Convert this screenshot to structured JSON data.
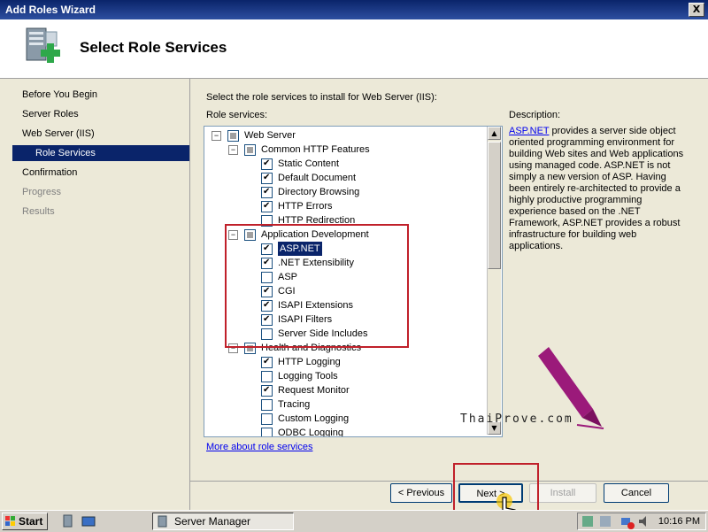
{
  "window": {
    "title": "Add Roles Wizard",
    "close_label": "X"
  },
  "header": {
    "title": "Select Role Services"
  },
  "nav": {
    "items": [
      {
        "label": "Before You Begin"
      },
      {
        "label": "Server Roles"
      },
      {
        "label": "Web Server (IIS)"
      },
      {
        "label": "Role Services"
      },
      {
        "label": "Confirmation"
      },
      {
        "label": "Progress"
      },
      {
        "label": "Results"
      }
    ]
  },
  "main": {
    "instruction": "Select the role services to install for Web Server (IIS):",
    "services_label": "Role services:",
    "description_label": "Description:",
    "description_link": "ASP.NET",
    "description_text": " provides a server side object oriented programming environment for building Web sites and Web applications using managed code. ASP.NET is not simply a new version of ASP. Having been entirely re-architected to provide a highly productive programming experience based on the .NET Framework, ASP.NET provides a robust infrastructure for building web applications.",
    "more_link": "More about role services"
  },
  "tree": [
    {
      "label": "Web Server",
      "state": "partial",
      "expander": "minus"
    },
    {
      "label": "Common HTTP Features",
      "state": "partial",
      "expander": "minus"
    },
    {
      "label": "Static Content",
      "state": "checked"
    },
    {
      "label": "Default Document",
      "state": "checked"
    },
    {
      "label": "Directory Browsing",
      "state": "checked"
    },
    {
      "label": "HTTP Errors",
      "state": "checked"
    },
    {
      "label": "HTTP Redirection",
      "state": "unchecked"
    },
    {
      "label": "Application Development",
      "state": "partial",
      "expander": "minus"
    },
    {
      "label": "ASP.NET",
      "state": "checked",
      "selected": true
    },
    {
      "label": ".NET Extensibility",
      "state": "checked"
    },
    {
      "label": "ASP",
      "state": "unchecked"
    },
    {
      "label": "CGI",
      "state": "checked"
    },
    {
      "label": "ISAPI Extensions",
      "state": "checked"
    },
    {
      "label": "ISAPI Filters",
      "state": "checked"
    },
    {
      "label": "Server Side Includes",
      "state": "unchecked"
    },
    {
      "label": "Health and Diagnostics",
      "state": "partial",
      "expander": "minus"
    },
    {
      "label": "HTTP Logging",
      "state": "checked"
    },
    {
      "label": "Logging Tools",
      "state": "unchecked"
    },
    {
      "label": "Request Monitor",
      "state": "checked"
    },
    {
      "label": "Tracing",
      "state": "unchecked"
    },
    {
      "label": "Custom Logging",
      "state": "unchecked"
    },
    {
      "label": "ODBC Logging",
      "state": "unchecked"
    }
  ],
  "buttons": {
    "previous": "< Previous",
    "next": "Next >",
    "install": "Install",
    "cancel": "Cancel"
  },
  "watermark": "ThaiProve.com",
  "taskbar": {
    "start": "Start",
    "task": "Server Manager",
    "clock": "10:16 PM"
  }
}
